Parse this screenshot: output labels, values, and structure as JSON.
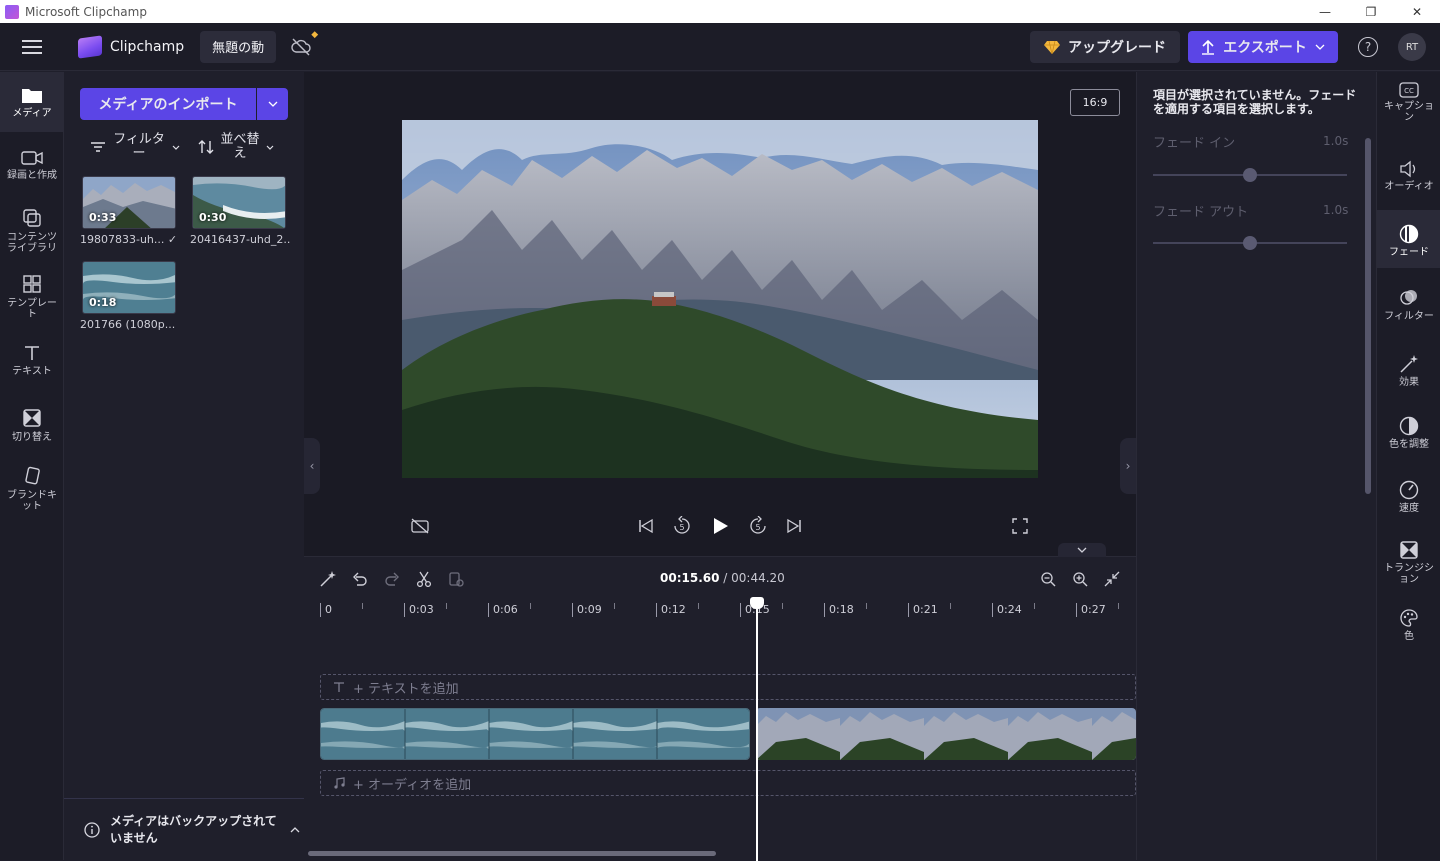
{
  "window": {
    "title": "Microsoft Clipchamp"
  },
  "topbar": {
    "brand": "Clipchamp",
    "project_title": "無題の動",
    "upgrade_label": "アップグレード",
    "export_label": "エクスポート",
    "help_label": "?",
    "avatar_initials": "RT"
  },
  "leftnav": {
    "items": [
      {
        "label": "メディア",
        "icon": "folder-icon"
      },
      {
        "label": "録画と作成",
        "icon": "camera-icon"
      },
      {
        "label": "コンテンツ ライブラリ",
        "icon": "library-icon"
      },
      {
        "label": "テンプレート",
        "icon": "template-icon"
      },
      {
        "label": "テキスト",
        "icon": "text-icon"
      },
      {
        "label": "切り替え",
        "icon": "transition-icon"
      },
      {
        "label": "ブランドキット",
        "icon": "brandkit-icon"
      }
    ]
  },
  "media": {
    "import_label": "メディアのインポート",
    "filter_label": "フィルター",
    "sort_label": "並べ替え",
    "items": [
      {
        "duration": "0:33",
        "name": "19807833-uh...",
        "checked": "✓"
      },
      {
        "duration": "0:30",
        "name": "20416437-uhd_2..."
      },
      {
        "duration": "0:18",
        "name": "201766 (1080p...",
        "checked": "✓"
      }
    ],
    "backup_message": "メディアはバックアップされていません"
  },
  "preview": {
    "aspect_ratio": "16:9"
  },
  "timeline": {
    "current_time": "00:15.60",
    "separator": " / ",
    "total_time": "00:44.20",
    "ticks": [
      "0",
      "0:03",
      "0:06",
      "0:09",
      "0:12",
      "0:15",
      "0:18",
      "0:21",
      "0:24",
      "0:27"
    ],
    "add_text_label": "+ テキストを追加",
    "add_audio_label": "+ オーディオを追加",
    "playhead_fraction": 0.57
  },
  "properties": {
    "message": "項目が選択されていません。フェードを適用する項目を選択します。",
    "fade_in_label": "フェード イン",
    "fade_in_value": "1.0s",
    "fade_out_label": "フェード アウト",
    "fade_out_value": "1.0s"
  },
  "rightnav": {
    "items": [
      {
        "label": "キャプション",
        "icon": "captions-icon"
      },
      {
        "label": "オーディオ",
        "icon": "speaker-icon"
      },
      {
        "label": "フェード",
        "icon": "fade-icon"
      },
      {
        "label": "フィルター",
        "icon": "filter-icon"
      },
      {
        "label": "効果",
        "icon": "magic-wand-icon"
      },
      {
        "label": "色を調整",
        "icon": "contrast-icon"
      },
      {
        "label": "速度",
        "icon": "speedometer-icon"
      },
      {
        "label": "トランジション",
        "icon": "transition-icon"
      },
      {
        "label": "色",
        "icon": "palette-icon"
      }
    ]
  },
  "colors": {
    "accent": "#5b45e6",
    "background": "#1f1f2b",
    "upgrade_gem": "#f3b73e"
  }
}
